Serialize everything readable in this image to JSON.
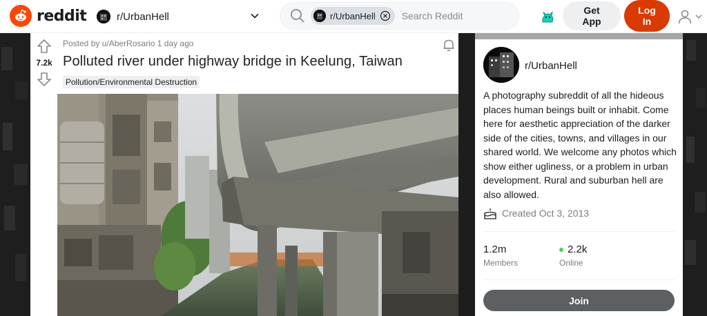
{
  "header": {
    "logo_text": "reddit",
    "community": "r/UrbanHell",
    "search_chip": "r/UrbanHell",
    "search_placeholder": "Search Reddit",
    "get_app_line1": "Get",
    "get_app_line2": "App",
    "login_line1": "Log",
    "login_line2": "In"
  },
  "post": {
    "votes": "7.2k",
    "meta": "Posted by u/AberRosario 1 day ago",
    "title": "Polluted river under highway bridge in Keelung, Taiwan",
    "flair": "Pollution/Environmental Destruction"
  },
  "sidebar": {
    "name": "r/UrbanHell",
    "description": "A photography subreddit of all the hideous places human beings built or inhabit. Come here for aesthetic appreciation of the darker side of the cities, towns, and villages in our shared world. We welcome any photos which show either ugliness, or a problem in urban development. Rural and suburban hell are also allowed.",
    "created": "Created Oct 3, 2013",
    "members_value": "1.2m",
    "members_label": "Members",
    "online_value": "2.2k",
    "online_label": "Online",
    "join_label": "Join"
  },
  "colors": {
    "brand": "#ff4500",
    "login": "#d93a00",
    "join": "#5c6062",
    "online": "#46d160"
  },
  "icons": [
    "reddit-logo-icon",
    "chevron-down-icon",
    "search-icon",
    "close-icon",
    "mascot-icon",
    "user-icon",
    "upvote-icon",
    "downvote-icon",
    "bell-icon",
    "cake-icon"
  ]
}
